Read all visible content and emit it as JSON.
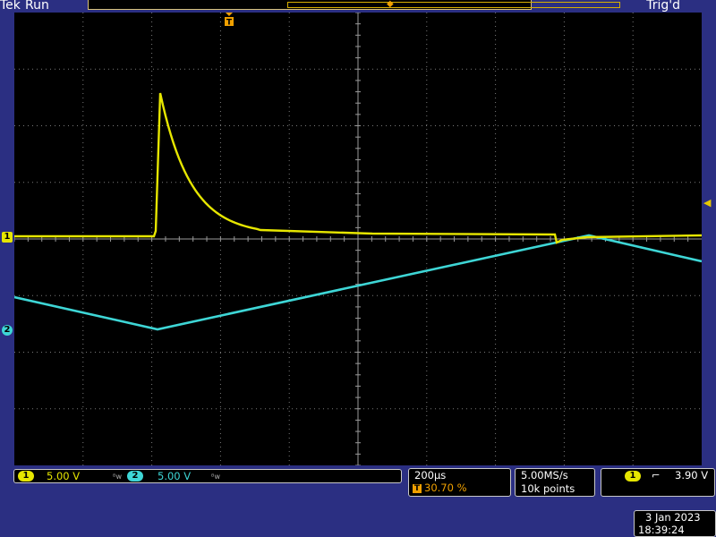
{
  "header": {
    "brand": "Tek",
    "run_state": "Run",
    "trigger_status": "Trig'd"
  },
  "channels": {
    "ch1": {
      "marker_label": "1",
      "scale": "5.00 V",
      "color": "#e6e600"
    },
    "ch2": {
      "marker_label": "2",
      "scale": "5.00 V",
      "color": "#3ed6d6"
    }
  },
  "timebase": {
    "scale": "200µs",
    "trigger_position": "30.70 %"
  },
  "acquisition": {
    "sample_rate": "5.00MS/s",
    "record_length": "10k points"
  },
  "trigger": {
    "source_label": "1",
    "slope_symbol": "⌐",
    "level": "3.90 V"
  },
  "timestamp": {
    "date": "3 Jan  2023",
    "time": "18:39:24"
  },
  "icons": {
    "trigger_marker": "trigger-position-marker",
    "trigger_level": "trigger-level-arrow",
    "bandwidth_limit": "bandwidth-limit-icon"
  },
  "colors": {
    "background_frame": "#2b2f82",
    "screen": "#000000",
    "grid": "#8a8a8a",
    "trigger_accent": "#f0a000"
  }
}
